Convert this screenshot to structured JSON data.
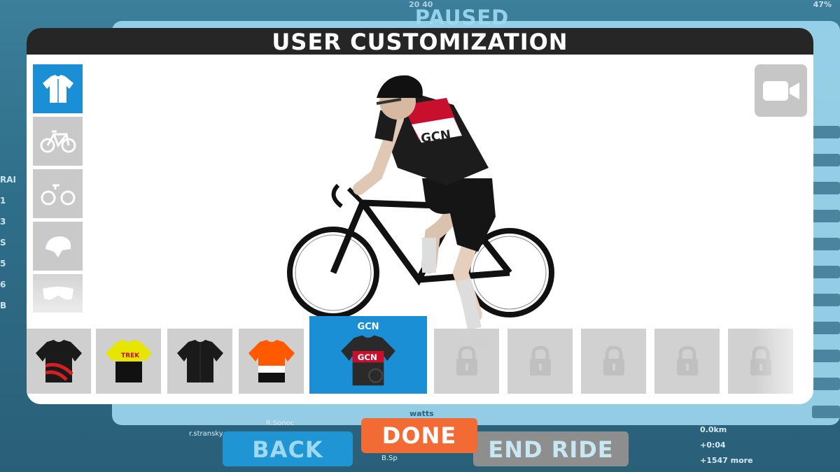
{
  "background": {
    "paused_title": "PAUSED",
    "speed_readout": "20 40",
    "grade_percent": "47%",
    "watts_label": "watts",
    "left_positions": [
      "RAI",
      "1",
      "3",
      "S",
      "5",
      "6",
      "B"
    ],
    "bottom_names": [
      "r.stransky",
      "B.Sp",
      "R.Sonoc"
    ],
    "right_stats": [
      "0.0km",
      "+0:04",
      "+1547 more"
    ]
  },
  "modal": {
    "title": "USER CUSTOMIZATION",
    "tabs": [
      {
        "name": "jersey",
        "icon": "jersey-icon"
      },
      {
        "name": "frame",
        "icon": "bike-frame-icon"
      },
      {
        "name": "wheels",
        "icon": "wheels-icon"
      },
      {
        "name": "helmet",
        "icon": "helmet-icon"
      },
      {
        "name": "glasses",
        "icon": "glasses-icon"
      }
    ],
    "active_tab": "jersey",
    "camera_icon": "camera-icon"
  },
  "jerseys": [
    {
      "label": "",
      "colors": [
        "#1a1a1a",
        "#d42020"
      ],
      "locked": false
    },
    {
      "label": "",
      "colors": [
        "#e6e600",
        "#111111"
      ],
      "locked": false
    },
    {
      "label": "",
      "colors": [
        "#1a1a1a",
        "#1a1a1a"
      ],
      "locked": false
    },
    {
      "label": "",
      "colors": [
        "#ff5a00",
        "#111111"
      ],
      "locked": false
    },
    {
      "label": "GCN",
      "colors": [
        "#c8102e",
        "#2a2a2a"
      ],
      "locked": false,
      "selected": true
    },
    {
      "label": "",
      "locked": true
    },
    {
      "label": "",
      "locked": true
    },
    {
      "label": "",
      "locked": true
    },
    {
      "label": "",
      "locked": true
    },
    {
      "label": "",
      "locked": true
    }
  ],
  "buttons": {
    "back": "BACK",
    "done": "DONE",
    "end_ride": "END RIDE"
  },
  "colors": {
    "accent_blue": "#1a8fd6",
    "done_orange": "#f26b34",
    "header_dark": "#262626"
  }
}
